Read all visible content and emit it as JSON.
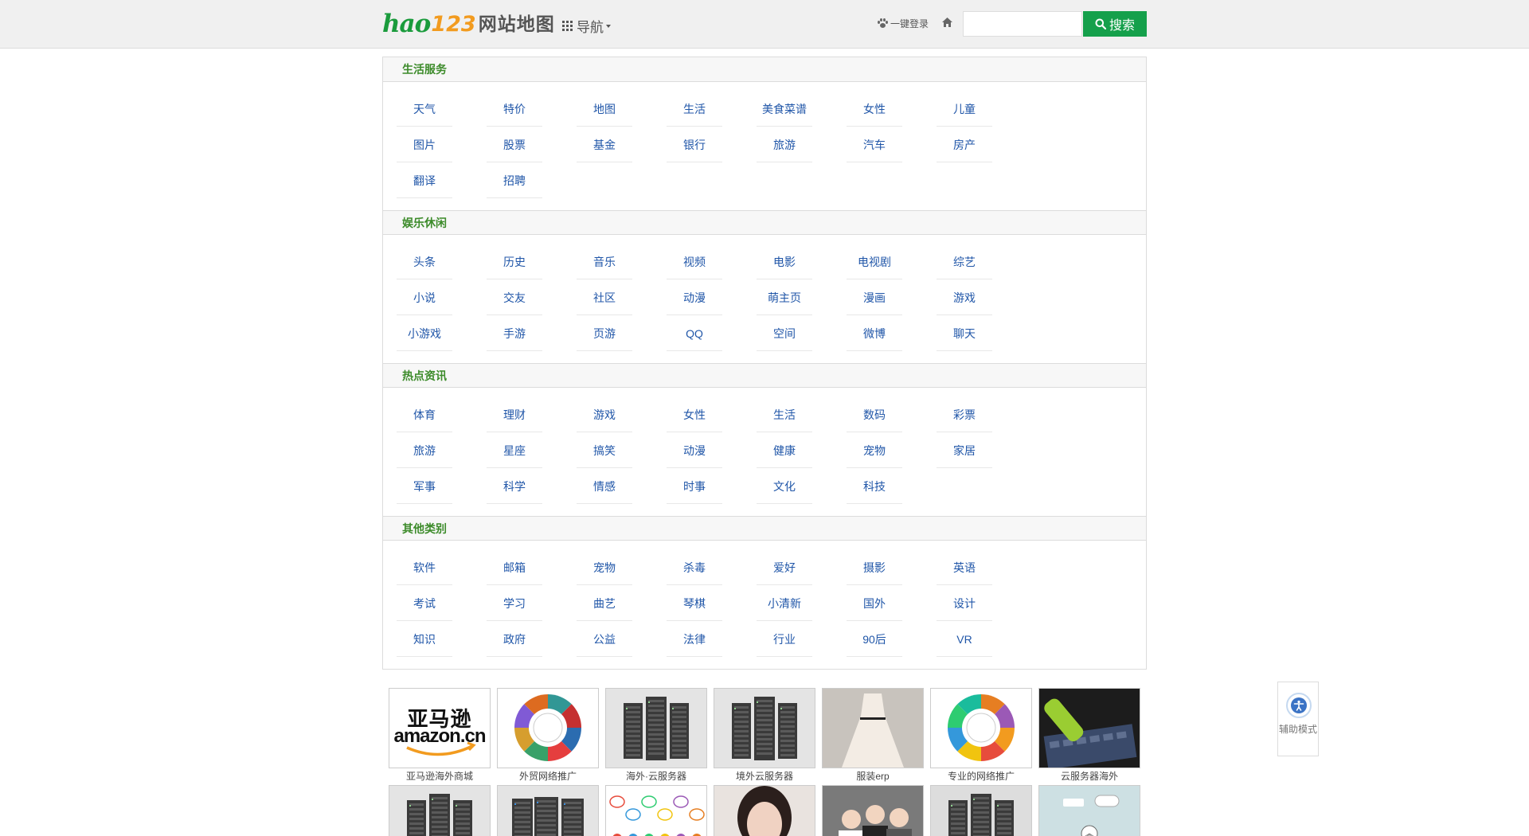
{
  "header": {
    "logo_hao": "hao",
    "logo_num": "123",
    "logo_title": "网站地图",
    "nav_label": "导航",
    "login_label": "一键登录",
    "search_placeholder": "",
    "search_button_label": "搜索",
    "brand_color": "#15a04b"
  },
  "sections": [
    {
      "title": "生活服务",
      "links": [
        "天气",
        "特价",
        "地图",
        "生活",
        "美食菜谱",
        "女性",
        "儿童",
        "图片",
        "股票",
        "基金",
        "银行",
        "旅游",
        "汽车",
        "房产",
        "翻译",
        "招聘"
      ]
    },
    {
      "title": "娱乐休闲",
      "links": [
        "头条",
        "历史",
        "音乐",
        "视频",
        "电影",
        "电视剧",
        "综艺",
        "小说",
        "交友",
        "社区",
        "动漫",
        "萌主页",
        "漫画",
        "游戏",
        "小游戏",
        "手游",
        "页游",
        "QQ",
        "空间",
        "微博",
        "聊天"
      ]
    },
    {
      "title": "热点资讯",
      "links": [
        "体育",
        "理财",
        "游戏",
        "女性",
        "生活",
        "数码",
        "彩票",
        "旅游",
        "星座",
        "搞笑",
        "动漫",
        "健康",
        "宠物",
        "家居",
        "军事",
        "科学",
        "情感",
        "时事",
        "文化",
        "科技"
      ]
    },
    {
      "title": "其他类别",
      "links": [
        "软件",
        "邮箱",
        "宠物",
        "杀毒",
        "爱好",
        "摄影",
        "英语",
        "考试",
        "学习",
        "曲艺",
        "琴棋",
        "小清新",
        "国外",
        "设计",
        "知识",
        "政府",
        "公益",
        "法律",
        "行业",
        "90后",
        "VR"
      ]
    }
  ],
  "ads": [
    {
      "caption": "亚马逊海外商城",
      "icon": "amazon-logo",
      "logo_top": "亚马逊",
      "logo_bottom": "amazon.cn"
    },
    {
      "caption": "外贸网络推广",
      "icon": "marketing-wheel"
    },
    {
      "caption": "海外·云服务器",
      "icon": "server-rack"
    },
    {
      "caption": "境外云服务器",
      "icon": "server-rack"
    },
    {
      "caption": "服装erp",
      "icon": "dress"
    },
    {
      "caption": "专业的网络推广",
      "icon": "element-wheel"
    },
    {
      "caption": "云服务器海外",
      "icon": "keyboard-vacuum"
    },
    {
      "caption": "",
      "icon": "server-rack"
    },
    {
      "caption": "",
      "icon": "server-cluster"
    },
    {
      "caption": "",
      "icon": "people-chat"
    },
    {
      "caption": "",
      "icon": "portrait"
    },
    {
      "caption": "",
      "icon": "teacher-students"
    },
    {
      "caption": "",
      "icon": "server-dark"
    },
    {
      "caption": "",
      "icon": "mind-map"
    }
  ],
  "assist": {
    "label": "辅助模式"
  }
}
